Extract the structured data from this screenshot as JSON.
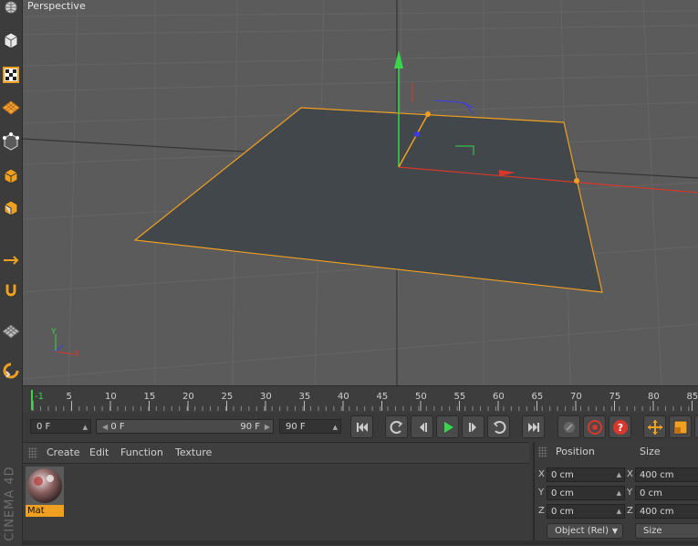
{
  "viewport": {
    "title": "Perspective",
    "axis_x": "X",
    "axis_y": "Y"
  },
  "timeline": {
    "ticks": [
      "-1",
      "5",
      "10",
      "15",
      "20",
      "25",
      "30",
      "35",
      "40",
      "45",
      "50",
      "55",
      "60",
      "65",
      "70",
      "75",
      "80",
      "85"
    ]
  },
  "transport": {
    "current_frame": "0 F",
    "range_start": "0 F",
    "range_end": "90 F",
    "max_frame": "90 F"
  },
  "material_manager": {
    "menu": [
      "Create",
      "Edit",
      "Function",
      "Texture"
    ],
    "materials": [
      {
        "name": "Mat"
      }
    ]
  },
  "brand": {
    "text": "CINEMA 4D"
  },
  "attributes": {
    "position_header": "Position",
    "size_header": "Size",
    "rows": [
      {
        "axis": "X",
        "position": "0 cm",
        "size_axis": "X",
        "size": "400 cm"
      },
      {
        "axis": "Y",
        "position": "0 cm",
        "size_axis": "Y",
        "size": "0 cm"
      },
      {
        "axis": "Z",
        "position": "0 cm",
        "size_axis": "Z",
        "size": "400 cm"
      }
    ],
    "coord_mode": "Object (Rel)",
    "size_mode": "Size"
  },
  "icons": [
    "cube-icon",
    "checker-icon",
    "grid-plane-icon",
    "subdivide-cube-icon",
    "deformer-icon",
    "cube-small-icon",
    "arrow-icon",
    "magnet-icon",
    "workplane-icon",
    "snap-icon"
  ],
  "colors": {
    "accent_orange": "#f0a020",
    "play_green": "#39d54a",
    "record_red": "#d8382c"
  }
}
